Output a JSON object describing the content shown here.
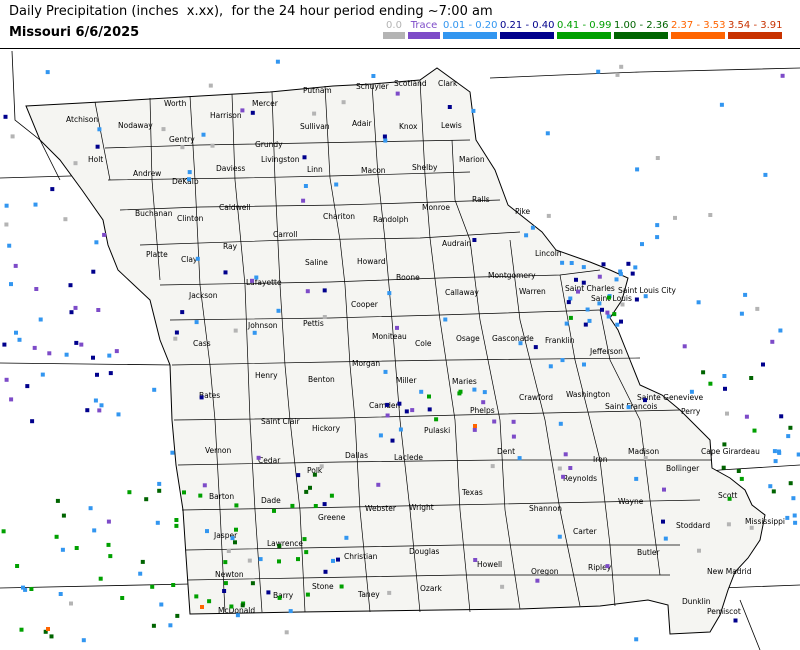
{
  "title": {
    "line1": "Daily Precipitation (inches  x.xx),  for the 24 hour period ending ~7:00 am",
    "line2": "Missouri 6/6/2025"
  },
  "legend": [
    {
      "label": "0.0",
      "color": "#b4b4b4"
    },
    {
      "label": "Trace",
      "color": "#7d4bc8"
    },
    {
      "label": "0.01 - 0.20",
      "color": "#3296f0"
    },
    {
      "label": "0.21 - 0.40",
      "color": "#00008c"
    },
    {
      "label": "0.41 - 0.99",
      "color": "#00a000"
    },
    {
      "label": "1.00 - 2.36",
      "color": "#006400"
    },
    {
      "label": "2.37 - 3.53",
      "color": "#ff6400"
    },
    {
      "label": "3.54 - 3.91",
      "color": "#c83200"
    }
  ],
  "counties": [
    {
      "name": "Atchison"
    },
    {
      "name": "Nodaway"
    },
    {
      "name": "Worth"
    },
    {
      "name": "Harrison"
    },
    {
      "name": "Mercer"
    },
    {
      "name": "Putnam"
    },
    {
      "name": "Schuyler"
    },
    {
      "name": "Scotland"
    },
    {
      "name": "Clark"
    },
    {
      "name": "Holt"
    },
    {
      "name": "Gentry"
    },
    {
      "name": "Grundy"
    },
    {
      "name": "Sullivan"
    },
    {
      "name": "Adair"
    },
    {
      "name": "Knox"
    },
    {
      "name": "Lewis"
    },
    {
      "name": "Andrew"
    },
    {
      "name": "DeKalb"
    },
    {
      "name": "Daviess"
    },
    {
      "name": "Livingston"
    },
    {
      "name": "Linn"
    },
    {
      "name": "Macon"
    },
    {
      "name": "Shelby"
    },
    {
      "name": "Marion"
    },
    {
      "name": "Buchanan"
    },
    {
      "name": "Clinton"
    },
    {
      "name": "Caldwell"
    },
    {
      "name": "Chariton"
    },
    {
      "name": "Randolph"
    },
    {
      "name": "Monroe"
    },
    {
      "name": "Ralls"
    },
    {
      "name": "Pike"
    },
    {
      "name": "Platte"
    },
    {
      "name": "Clay"
    },
    {
      "name": "Ray"
    },
    {
      "name": "Carroll"
    },
    {
      "name": "Howard"
    },
    {
      "name": "Audrain"
    },
    {
      "name": "Lincoln"
    },
    {
      "name": "Saline"
    },
    {
      "name": "Boone"
    },
    {
      "name": "Montgomery"
    },
    {
      "name": "Callaway"
    },
    {
      "name": "Warren"
    },
    {
      "name": "Saint Charles"
    },
    {
      "name": "Saint Louis City"
    },
    {
      "name": "Saint Louis"
    },
    {
      "name": "Jackson"
    },
    {
      "name": "Lafayette"
    },
    {
      "name": "Cooper"
    },
    {
      "name": "Johnson"
    },
    {
      "name": "Pettis"
    },
    {
      "name": "Moniteau"
    },
    {
      "name": "Cole"
    },
    {
      "name": "Osage"
    },
    {
      "name": "Gasconade"
    },
    {
      "name": "Franklin"
    },
    {
      "name": "Jefferson"
    },
    {
      "name": "Cass"
    },
    {
      "name": "Morgan"
    },
    {
      "name": "Henry"
    },
    {
      "name": "Benton"
    },
    {
      "name": "Miller"
    },
    {
      "name": "Maries"
    },
    {
      "name": "Bates"
    },
    {
      "name": "Camden"
    },
    {
      "name": "Crawford"
    },
    {
      "name": "Washington"
    },
    {
      "name": "Sainte Genevieve"
    },
    {
      "name": "Saint Francois"
    },
    {
      "name": "Perry"
    },
    {
      "name": "Saint Clair"
    },
    {
      "name": "Phelps"
    },
    {
      "name": "Pulaski"
    },
    {
      "name": "Vernon"
    },
    {
      "name": "Hickory"
    },
    {
      "name": "Dallas"
    },
    {
      "name": "Laclede"
    },
    {
      "name": "Dent"
    },
    {
      "name": "Iron"
    },
    {
      "name": "Madison"
    },
    {
      "name": "Cape Girardeau"
    },
    {
      "name": "Cedar"
    },
    {
      "name": "Polk"
    },
    {
      "name": "Bollinger"
    },
    {
      "name": "Reynolds"
    },
    {
      "name": "Barton"
    },
    {
      "name": "Dade"
    },
    {
      "name": "Texas"
    },
    {
      "name": "Wayne"
    },
    {
      "name": "Scott"
    },
    {
      "name": "Greene"
    },
    {
      "name": "Webster"
    },
    {
      "name": "Wright"
    },
    {
      "name": "Shannon"
    },
    {
      "name": "Stoddard"
    },
    {
      "name": "Jasper"
    },
    {
      "name": "Lawrence"
    },
    {
      "name": "Carter"
    },
    {
      "name": "Mississippi"
    },
    {
      "name": "Christian"
    },
    {
      "name": "Douglas"
    },
    {
      "name": "Butler"
    },
    {
      "name": "Newton"
    },
    {
      "name": "Howell"
    },
    {
      "name": "Oregon"
    },
    {
      "name": "Ripley"
    },
    {
      "name": "New Madrid"
    },
    {
      "name": "Stone"
    },
    {
      "name": "Barry"
    },
    {
      "name": "Taney"
    },
    {
      "name": "Ozark"
    },
    {
      "name": "Dunklin"
    },
    {
      "name": "McDonald"
    },
    {
      "name": "Pemiscot"
    }
  ],
  "colors": {
    "state_fill": "#f5f5f2",
    "border": "#000000"
  }
}
